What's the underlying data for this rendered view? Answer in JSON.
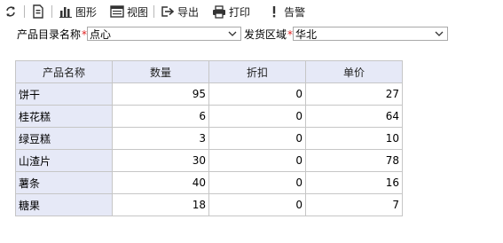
{
  "toolbar": {
    "refresh_icon": "refresh-icon",
    "export_file_icon": "file-icon",
    "chart_label": "图形",
    "view_label": "视图",
    "export_label": "导出",
    "print_label": "打印",
    "alert_label": "告警"
  },
  "filters": {
    "catalog_label": "产品目录名称",
    "catalog_required": "*",
    "catalog_value": "点心",
    "region_label": "发货区域",
    "region_required": "*",
    "region_value": "华北"
  },
  "table": {
    "headers": [
      "产品名称",
      "数量",
      "折扣",
      "单价"
    ],
    "rows": [
      [
        "饼干",
        "95",
        "0",
        "27"
      ],
      [
        "桂花糕",
        "6",
        "0",
        "64"
      ],
      [
        "绿豆糕",
        "3",
        "0",
        "10"
      ],
      [
        "山渣片",
        "30",
        "0",
        "78"
      ],
      [
        "薯条",
        "40",
        "0",
        "16"
      ],
      [
        "糖果",
        "18",
        "0",
        "7"
      ]
    ]
  },
  "colors": {
    "header_bg": "#e6e9f7",
    "border": "#c6c6c6",
    "required": "#e02020"
  }
}
